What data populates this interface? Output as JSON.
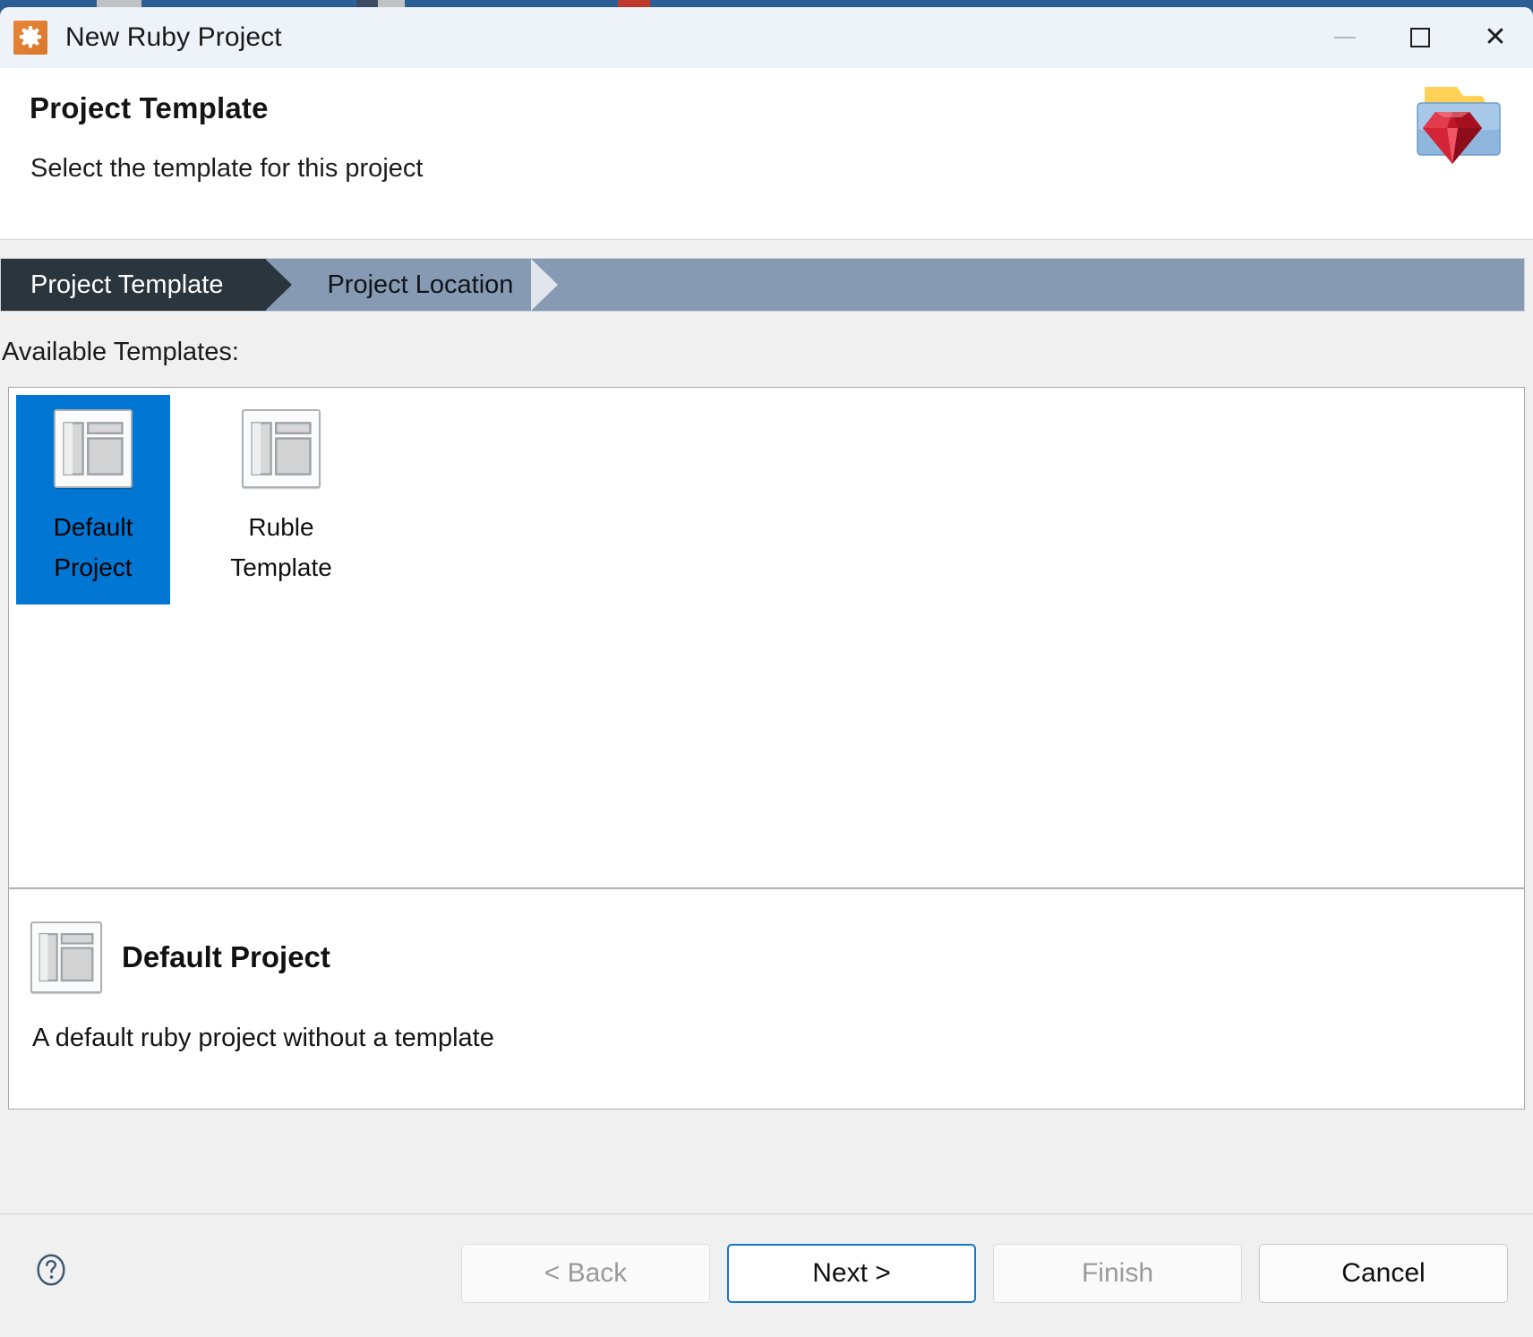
{
  "window": {
    "title": "New Ruby Project",
    "app_icon": "gear-icon",
    "minimize_label": "Minimize",
    "maximize_label": "Maximize",
    "close_label": "Close",
    "close_glyph": "✕"
  },
  "header": {
    "title": "Project Template",
    "subtitle": "Select the template for this project",
    "decorative_icon": "ruby-folder-icon"
  },
  "steps": [
    {
      "label": "Project Template",
      "state": "active"
    },
    {
      "label": "Project Location",
      "state": "inactive"
    }
  ],
  "templates_section": {
    "label": "Available Templates:",
    "items": [
      {
        "name": "Default Project",
        "line1": "Default",
        "line2": "Project",
        "icon": "layout-icon",
        "selected": true
      },
      {
        "name": "Ruble Template",
        "line1": "Ruble",
        "line2": "Template",
        "icon": "layout-icon",
        "selected": false
      }
    ]
  },
  "description": {
    "icon": "layout-icon",
    "title": "Default Project",
    "text": "A default ruby project without a template"
  },
  "buttons": {
    "help": {
      "label": "?",
      "icon": "help-circle-icon"
    },
    "back": {
      "label": "< Back",
      "enabled": false
    },
    "next": {
      "label": "Next >",
      "enabled": true,
      "focused": true
    },
    "finish": {
      "label": "Finish",
      "enabled": false
    },
    "cancel": {
      "label": "Cancel",
      "enabled": true
    }
  },
  "colors": {
    "accent_selected": "#0176d3",
    "step_active_bg": "#2b353d",
    "step_inactive_bg": "#869ab4",
    "titlebar_bg": "#eef3fa",
    "dialog_bg": "#f0f0f0",
    "focus_border": "#1876c9",
    "desktop_blue": "#2b5f93"
  }
}
